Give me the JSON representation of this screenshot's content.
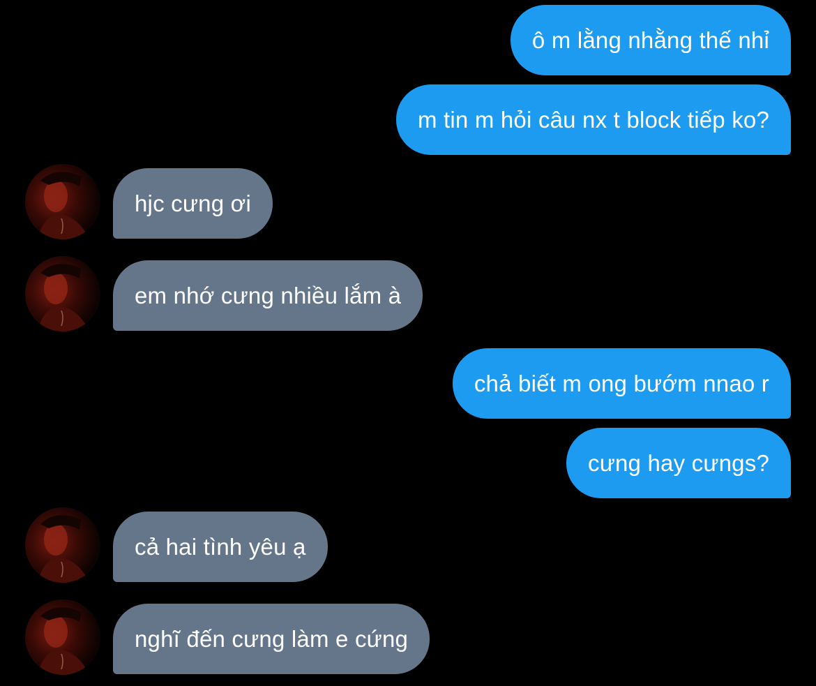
{
  "messages": [
    {
      "side": "sent",
      "text": "ô m lằng nhằng thế nhỉ"
    },
    {
      "side": "sent",
      "text": "m tin m hỏi câu nx t block tiếp ko?"
    },
    {
      "side": "received",
      "text": "hjc cưng ơi"
    },
    {
      "side": "received",
      "text": "em nhớ cưng nhiều lắm à"
    },
    {
      "side": "sent",
      "text": "chả biết m ong bướm nnao r"
    },
    {
      "side": "sent",
      "text": "cưng hay cưngs?"
    },
    {
      "side": "received",
      "text": "cả hai tình yêu ạ"
    },
    {
      "side": "received",
      "text": "nghĩ đến cưng làm e cứng"
    }
  ],
  "colors": {
    "background": "#000000",
    "sent_bubble": "#1d9bf0",
    "received_bubble": "#66768a",
    "text": "#ffffff"
  },
  "icons": {
    "avatar": "contact-avatar-photo"
  }
}
